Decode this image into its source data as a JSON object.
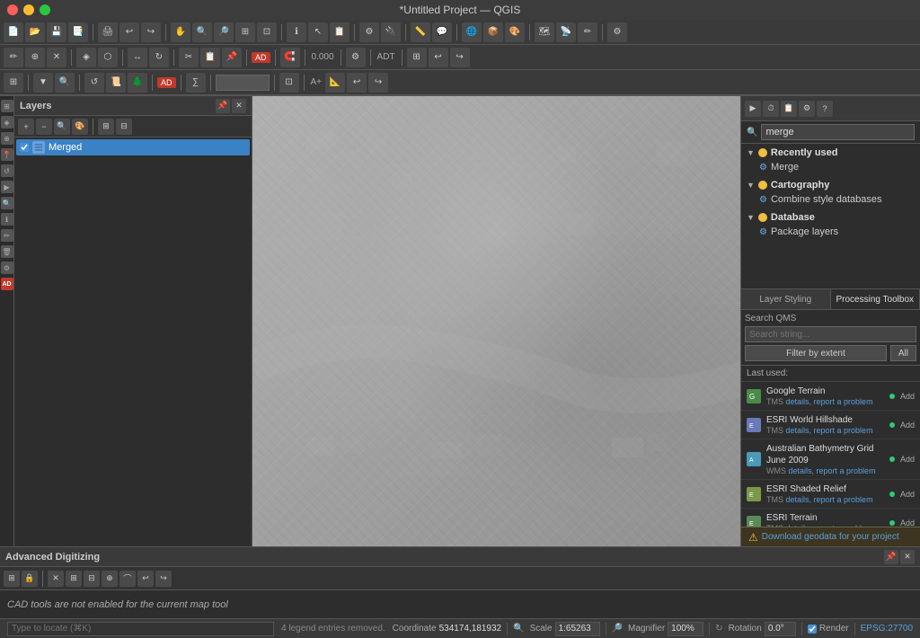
{
  "app": {
    "title": "*Untitled Project — QGIS"
  },
  "titlebar": {
    "close_btn": "●",
    "min_btn": "●",
    "max_btn": "●"
  },
  "layers_panel": {
    "title": "Layers",
    "layer": {
      "name": "Merged",
      "checked": true
    }
  },
  "processing_toolbox": {
    "title": "Processing Toolbox",
    "search_placeholder": "merge",
    "search_value": "merge",
    "recently_used": {
      "label": "Recently used",
      "items": [
        {
          "name": "Merge",
          "icon": "gear"
        }
      ]
    },
    "cartography": {
      "label": "Cartography",
      "items": [
        {
          "name": "Combine style databases",
          "icon": "gear"
        }
      ]
    },
    "database": {
      "label": "Database",
      "items": [
        {
          "name": "Package layers",
          "icon": "gear"
        }
      ]
    }
  },
  "right_tabs": {
    "layer_styling": "Layer Styling",
    "processing_toolbox": "Processing Toolbox"
  },
  "qms": {
    "section_label": "Search QMS",
    "placeholder": "Search string...",
    "btn_filter": "Filter by extent",
    "btn_all": "All",
    "last_used_label": "Last used:",
    "services": [
      {
        "name": "Google Terrain",
        "type": "TMS",
        "details_link": "details",
        "report_link": "report a problem",
        "add_label": "Add",
        "dot_color": "#2ecc71",
        "icon_color": "#4a8a4a",
        "icon_text": "🗺"
      },
      {
        "name": "ESRI World Hillshade",
        "type": "TMS",
        "details_link": "details",
        "report_link": "report a problem",
        "add_label": "Add",
        "dot_color": "#2ecc71",
        "icon_color": "#6a7ab8",
        "icon_text": "🏔"
      },
      {
        "name": "Australian Bathymetry Grid June 2009",
        "type": "WMS",
        "details_link": "details",
        "report_link": "report a problem",
        "add_label": "Add",
        "dot_color": "#2ecc71",
        "icon_color": "#4a9ab8",
        "icon_text": "🌊"
      },
      {
        "name": "ESRI Shaded Relief",
        "type": "TMS",
        "details_link": "details",
        "report_link": "report a problem",
        "add_label": "Add",
        "dot_color": "#2ecc71",
        "icon_color": "#7a9a4a",
        "icon_text": "🏔"
      },
      {
        "name": "ESRI Terrain",
        "type": "TMS",
        "details_link": "details",
        "report_link": "report a problem",
        "add_label": "Add",
        "dot_color": "#2ecc71",
        "icon_color": "#5a8a5a",
        "icon_text": "🗻"
      }
    ]
  },
  "adv_digitizing": {
    "title": "Advanced Digitizing",
    "status_msg": "CAD tools are not enabled for the current map tool"
  },
  "statusbar": {
    "locate_placeholder": "Type to locate (⌘K)",
    "legend_msg": "4 legend entries removed.",
    "coordinate_label": "Coordinate",
    "coordinate_value": "534174,181932",
    "scale_label": "Scale",
    "scale_value": "1:65263",
    "magnifier_label": "Magnifier",
    "magnifier_value": "100%",
    "rotation_label": "Rotation",
    "rotation_value": "0.0°",
    "render_label": "Render",
    "crs_value": "EPSG:27700"
  },
  "geodata_bar": {
    "message": "Download geodata for your project",
    "icon": "⚠"
  },
  "colors": {
    "accent_blue": "#3a82c4",
    "link_blue": "#5a9fd8",
    "status_green": "#2ecc71",
    "warning_yellow": "#f0c040"
  }
}
